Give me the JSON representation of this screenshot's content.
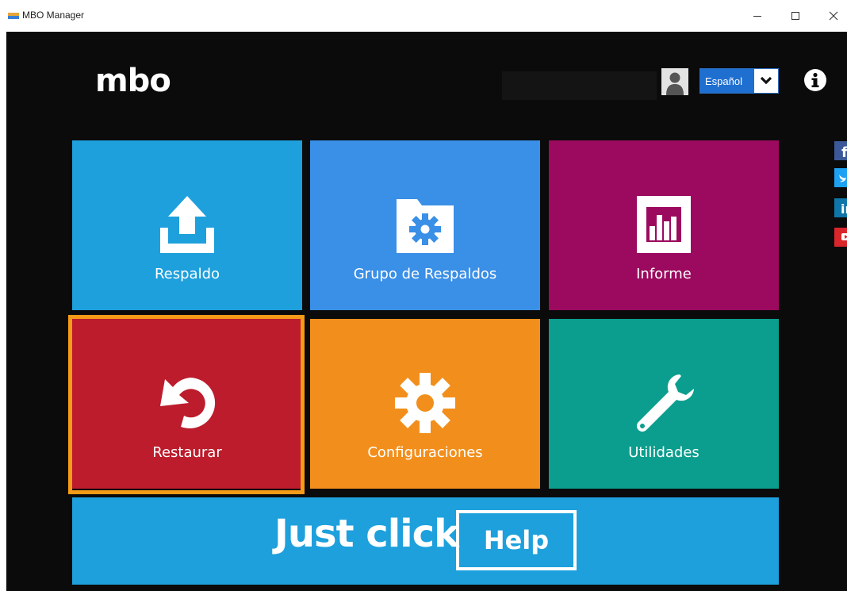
{
  "window": {
    "title": "MBO Manager"
  },
  "header": {
    "logo": "mbo",
    "language": {
      "selected": "Español"
    },
    "icons": {
      "avatar": "user-avatar-icon",
      "info": "info-icon"
    }
  },
  "social": [
    "facebook-icon",
    "twitter-icon",
    "linkedin-icon",
    "youtube-icon"
  ],
  "tiles": [
    {
      "label": "Respaldo",
      "icon": "upload-icon",
      "color": "#1ea0dc"
    },
    {
      "label": "Grupo de Respaldos",
      "icon": "folder-gear-icon",
      "color": "#3a8fe6"
    },
    {
      "label": "Informe",
      "icon": "bar-chart-icon",
      "color": "#9b0a5e"
    },
    {
      "label": "Restaurar",
      "icon": "restore-icon",
      "color": "#bc1c2c",
      "selected": true
    },
    {
      "label": "Configuraciones",
      "icon": "gear-icon",
      "color": "#f28f1c"
    },
    {
      "label": "Utilidades",
      "icon": "wrench-icon",
      "color": "#0b9e8e"
    }
  ],
  "banner": {
    "text": "Just click",
    "button": "Help",
    "color": "#1ea0dc"
  },
  "colors": {
    "highlight": "#f59b17",
    "background": "#0b0b0b",
    "language_select": "#1f6fd1"
  }
}
